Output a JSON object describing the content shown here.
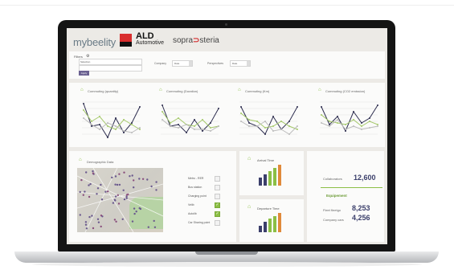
{
  "logos": {
    "mybeelity_text": "mybeelity",
    "ald_name": "ALD",
    "ald_sub": "Automotive",
    "sopra_text": "sopra",
    "steria_text": "steria"
  },
  "filters": {
    "title": "Filters",
    "field1": "Sélection",
    "field2": "",
    "apply_label": "Apply",
    "company_label": "Company",
    "company_value": "Date",
    "perspective_label": "Perspectives",
    "perspective_value": "Date"
  },
  "charts": [
    {
      "title": "Commuting (quantity)"
    },
    {
      "title": "Commuting (Duration)"
    },
    {
      "title": "Commuting (Km)"
    },
    {
      "title": "Commuting (CO2 emission)"
    }
  ],
  "demographic": {
    "title": "Demographic Data",
    "legend": [
      {
        "label": "Metro - RER",
        "checked": false
      },
      {
        "label": "Bus station",
        "checked": false
      },
      {
        "label": "Charging point",
        "checked": false
      },
      {
        "label": "Velib",
        "checked": true
      },
      {
        "label": "Autolib",
        "checked": true
      },
      {
        "label": "Car Sharing point",
        "checked": false
      }
    ]
  },
  "arrival": {
    "title": "Arrival Time"
  },
  "departure": {
    "title": "Departure Time"
  },
  "kpis": {
    "collaborators_label": "Collaborators",
    "collaborators_value": "12,600",
    "equipment_title": "Equipement",
    "fleet_label": "Fleet fleetgo",
    "fleet_value": "8,253",
    "company_car_label": "Company cars",
    "company_car_value": "4,256"
  },
  "colors": {
    "accent_green": "#8cbf45",
    "navy": "#3b3f6b",
    "apply_purple": "#6a6191"
  }
}
